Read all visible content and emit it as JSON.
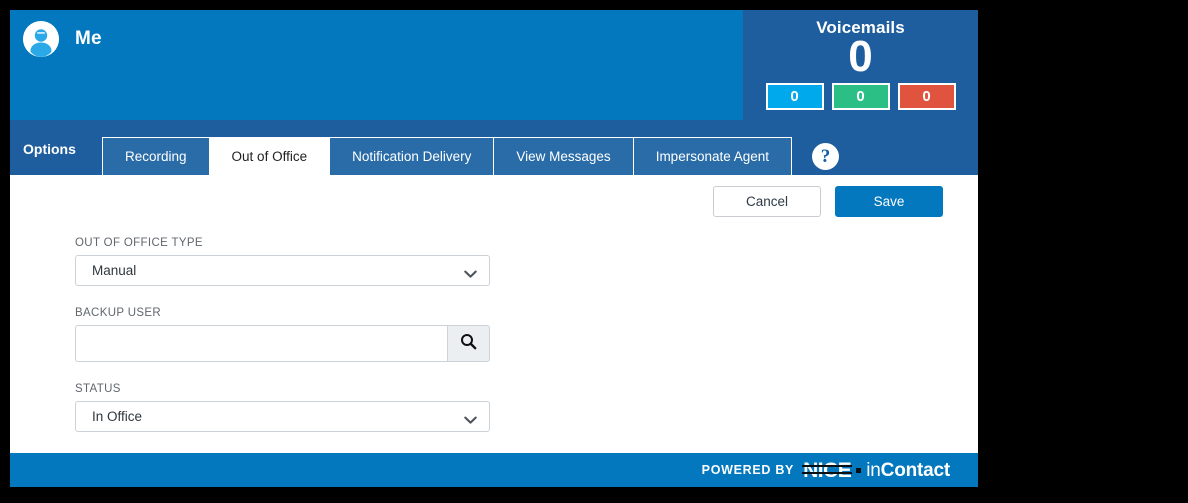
{
  "header": {
    "user_name": "Me",
    "avatar_icon": "user-avatar-icon",
    "voicemails": {
      "title": "Voicemails",
      "count": "0",
      "badges": [
        {
          "value": "0",
          "color": "#00a8ec",
          "name": "new"
        },
        {
          "value": "0",
          "color": "#2bbf86",
          "name": "saved"
        },
        {
          "value": "0",
          "color": "#e0543f",
          "name": "urgent"
        }
      ]
    }
  },
  "tabbar": {
    "options_label": "Options",
    "help_icon": "question-mark-icon",
    "help_label": "?",
    "tabs": [
      {
        "label": "Recording",
        "active": false
      },
      {
        "label": "Out of Office",
        "active": true
      },
      {
        "label": "Notification Delivery",
        "active": false
      },
      {
        "label": "View Messages",
        "active": false
      },
      {
        "label": "Impersonate Agent",
        "active": false
      }
    ]
  },
  "actions": {
    "cancel_label": "Cancel",
    "save_label": "Save"
  },
  "form": {
    "out_of_office_type": {
      "label": "OUT OF OFFICE TYPE",
      "value": "Manual",
      "options": [
        "Manual"
      ],
      "chevron_icon": "chevron-down-icon"
    },
    "backup_user": {
      "label": "BACKUP USER",
      "value": "",
      "placeholder": "",
      "search_icon": "search-icon"
    },
    "status": {
      "label": "STATUS",
      "value": "In Office",
      "options": [
        "In Office"
      ],
      "chevron_icon": "chevron-down-icon"
    }
  },
  "footer": {
    "powered_by": "POWERED BY",
    "brand_nice": "NICE",
    "brand_in": "in",
    "brand_contact": "Contact"
  },
  "colors": {
    "header_blue": "#0378be",
    "panel_blue": "#1f5e9e",
    "tab_blue": "#2a6ca8",
    "accent_blue": "#00a8ec",
    "accent_green": "#2bbf86",
    "accent_red": "#e0543f"
  }
}
